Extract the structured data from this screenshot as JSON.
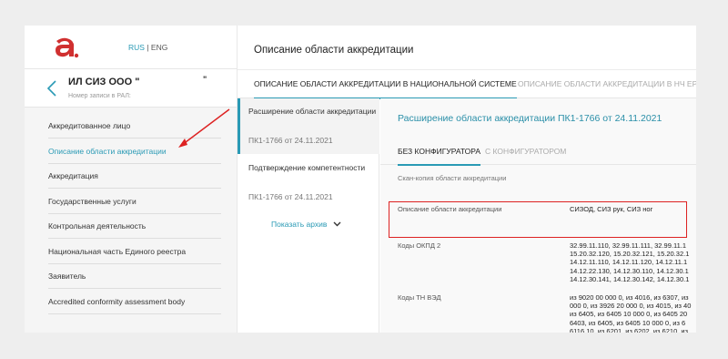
{
  "header": {
    "lang_ru": "RUS",
    "lang_sep": "|",
    "lang_en": "ENG"
  },
  "org": {
    "name": "ИЛ СИЗ ООО \"",
    "reg_label": "Номер записи в РАЛ:",
    "mark": "\""
  },
  "sidebar": {
    "items": [
      {
        "label": "Аккредитованное лицо"
      },
      {
        "label": "Описание области аккредитации"
      },
      {
        "label": "Аккредитация"
      },
      {
        "label": "Государственные услуги"
      },
      {
        "label": "Контрольная деятельность"
      },
      {
        "label": "Национальная часть Единого реестра"
      },
      {
        "label": "Заявитель"
      },
      {
        "label": "Accredited conformity assessment body"
      }
    ],
    "active_index": 1
  },
  "main": {
    "title": "Описание области аккредитации",
    "tabs": [
      {
        "label": "ОПИСАНИЕ ОБЛАСТИ АККРЕДИТАЦИИ В НАЦИОНАЛЬНОЙ СИСТЕМЕ"
      },
      {
        "label": "ОПИСАНИЕ ОБЛАСТИ АККРЕДИТАЦИИ В НЧ ЕР"
      }
    ]
  },
  "list": {
    "items": [
      {
        "title": "Расширение области аккредитации",
        "sub": "ПК1-1766 от 24.11.2021"
      },
      {
        "title": "Подтверждение компетентности",
        "sub": "ПК1-1766 от 24.11.2021"
      }
    ],
    "archive_label": "Показать архив"
  },
  "detail": {
    "title": "Расширение области аккредитации ПК1-1766 от 24.11.2021",
    "subtabs": [
      {
        "label": "БЕЗ КОНФИГУРАТОРА"
      },
      {
        "label": "С КОНФИГУРАТОРОМ"
      }
    ],
    "scan_label": "Скан-копия области аккредитации",
    "rows": [
      {
        "label": "Описание области аккредитации",
        "value": "СИЗОД, СИЗ рук, СИЗ ног"
      },
      {
        "label": "Коды ОКПД 2",
        "value": "32.99.11.110, 32.99.11.111, 32.99.11.1\n15.20.32.120, 15.20.32.121, 15.20.32.1\n14.12.11.110, 14.12.11.120, 14.12.11.1\n14.12.22.130, 14.12.30.110, 14.12.30.1\n14.12.30.141, 14.12.30.142, 14.12.30.1"
      },
      {
        "label": "Коды ТН ВЭД",
        "value": "из 9020 00 000 0, из 4016, из 6307, из\n000 0, из 3926 20 000 0, из 4015, из 40\nиз 6405, из 6405 10 000 0, из 6405 20\n6403, из 6405, из 6405 10 000 0, из 6\n6116 10, из 6201, из 6202, из 6210, из"
      }
    ]
  },
  "colors": {
    "accent": "#2a9ab5",
    "highlight": "#dd2222",
    "logo": "#d03030"
  },
  "icons": {
    "logo": "brand-logo",
    "back": "chevron-left-icon",
    "archive": "chevron-down-icon",
    "annotation": "red-arrow"
  }
}
